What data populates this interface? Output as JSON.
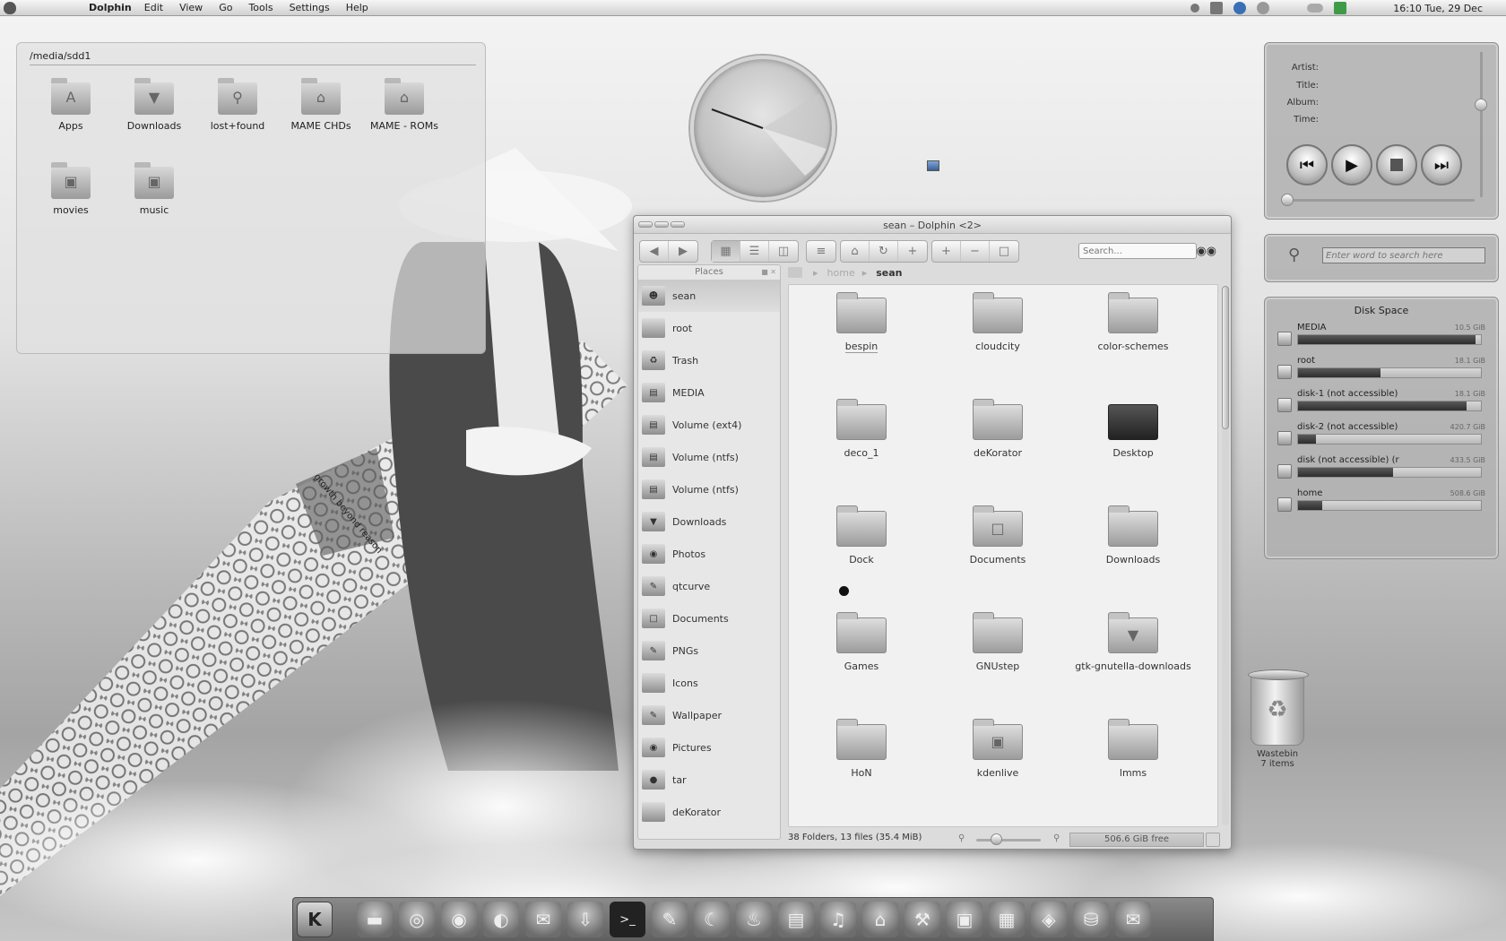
{
  "menubar": {
    "app_name": "Dolphin",
    "menus": [
      "Edit",
      "View",
      "Go",
      "Tools",
      "Settings",
      "Help"
    ],
    "clock": "16:10 Tue, 29 Dec"
  },
  "folderview": {
    "path": "/media/sdd1",
    "items": [
      {
        "label": "Apps",
        "icon": "app-store-icon"
      },
      {
        "label": "Downloads",
        "icon": "download-icon"
      },
      {
        "label": "lost+found",
        "icon": "magnifier-icon"
      },
      {
        "label": "MAME CHDs",
        "icon": "columns-icon"
      },
      {
        "label": "MAME - ROMs",
        "icon": "columns-icon"
      },
      {
        "label": "movies",
        "icon": "film-icon"
      },
      {
        "label": "music",
        "icon": "film-icon"
      }
    ]
  },
  "wallpaper": {
    "caption": "growth beyond reason"
  },
  "dolphin": {
    "title": "sean – Dolphin <2>",
    "search_placeholder": "Search...",
    "places_title": "Places",
    "places": [
      "sean",
      "root",
      "Trash",
      "MEDIA",
      "Volume (ext4)",
      "Volume (ntfs)",
      "Volume (ntfs)",
      "Downloads",
      "Photos",
      "qtcurve",
      "Documents",
      "PNGs",
      "Icons",
      "Wallpaper",
      "Pictures",
      "tar",
      "deKorator"
    ],
    "breadcrumb": {
      "parent": "home",
      "current": "sean"
    },
    "files": [
      {
        "label": "bespin",
        "icon": "folder-icon"
      },
      {
        "label": "cloudcity",
        "icon": "folder-icon"
      },
      {
        "label": "color-schemes",
        "icon": "folder-icon"
      },
      {
        "label": "deco_1",
        "icon": "folder-icon"
      },
      {
        "label": "deKorator",
        "icon": "folder-icon"
      },
      {
        "label": "Desktop",
        "icon": "desktop-icon"
      },
      {
        "label": "Dock",
        "icon": "folder-icon"
      },
      {
        "label": "Documents",
        "icon": "document-folder-icon"
      },
      {
        "label": "Downloads",
        "icon": "folder-icon"
      },
      {
        "label": "Games",
        "icon": "folder-icon"
      },
      {
        "label": "GNUstep",
        "icon": "folder-icon"
      },
      {
        "label": "gtk-gnutella-downloads",
        "icon": "download-folder-icon"
      },
      {
        "label": "HoN",
        "icon": "folder-icon"
      },
      {
        "label": "kdenlive",
        "icon": "film-folder-icon"
      },
      {
        "label": "lmms",
        "icon": "folder-icon"
      }
    ],
    "status": "38 Folders, 13 files (35.4 MiB)",
    "free_space": "506.6 GiB free"
  },
  "now_playing": {
    "labels": [
      "Artist:",
      "Title:",
      "Album:",
      "Time:"
    ]
  },
  "dictionary": {
    "placeholder": "Enter word to search here"
  },
  "disk_space": {
    "title": "Disk Space",
    "disks": [
      {
        "name": "MEDIA",
        "size": "10.5 GiB",
        "used": 0.97
      },
      {
        "name": "root",
        "size": "18.1 GiB",
        "used": 0.45
      },
      {
        "name": "disk-1 (not accessible)",
        "size": "18.1 GiB",
        "used": 0.92
      },
      {
        "name": "disk-2 (not accessible)",
        "size": "420.7 GiB",
        "used": 0.1
      },
      {
        "name": "disk (not accessible) (r",
        "size": "433.5 GiB",
        "used": 0.52
      },
      {
        "name": "home",
        "size": "508.6 GiB",
        "used": 0.13
      }
    ]
  },
  "wastebin": {
    "label": "Wastebin",
    "count": "7 items"
  },
  "dock": {
    "items": [
      "kde-icon",
      "screen-icon",
      "chrome-icon",
      "firefox-icon",
      "globe-icon",
      "mail-stamp-icon",
      "download-arrow-icon",
      "terminal-icon",
      "inkscape-icon",
      "wolf-icon",
      "flame-icon",
      "archive-icon",
      "audio-doc-icon",
      "colosseum-icon",
      "tools-icon",
      "monitor-icon",
      "photo-icon",
      "nvidia-icon",
      "network-icon",
      "envelope-icon"
    ]
  }
}
